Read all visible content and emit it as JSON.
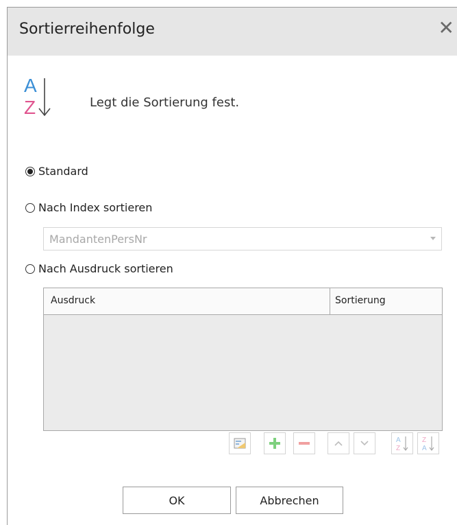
{
  "dialog": {
    "title": "Sortierreihenfolge",
    "close_icon": "close-icon",
    "header_icon": "sort-az-icon",
    "subtitle": "Legt die Sortierung fest."
  },
  "options": {
    "standard": {
      "label": "Standard",
      "checked": true
    },
    "by_index": {
      "label": "Nach Index sortieren",
      "checked": false
    },
    "by_expression": {
      "label": "Nach Ausdruck sortieren",
      "checked": false
    }
  },
  "index_select": {
    "value": "MandantenPersNr"
  },
  "grid": {
    "columns": [
      "Ausdruck",
      "Sortierung"
    ],
    "rows": []
  },
  "toolbar": {
    "buttons": [
      "expression-editor-icon",
      "add-icon",
      "remove-icon",
      "move-up-icon",
      "move-down-icon",
      "sort-ascending-icon",
      "sort-descending-icon"
    ]
  },
  "buttons": {
    "ok": "OK",
    "cancel": "Abbrechen"
  },
  "colors": {
    "titlebar_bg": "#e6e6e6",
    "icon_blue": "#3b8fd6",
    "icon_pink": "#e0558f",
    "add_green": "#7ed07e",
    "remove_red": "#f1a0a0"
  }
}
